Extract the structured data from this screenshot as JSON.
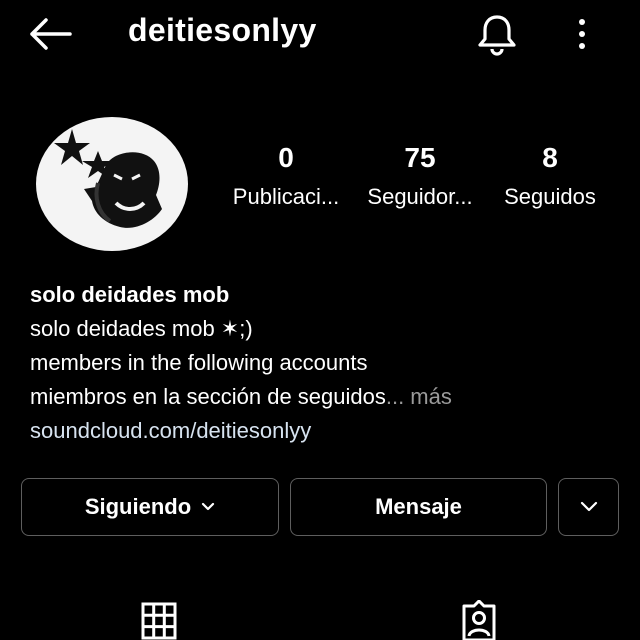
{
  "header": {
    "username": "deitiesonlyy",
    "back_icon": "arrow-left-icon",
    "notifications_icon": "bell-icon",
    "menu_icon": "more-vertical-icon"
  },
  "profile": {
    "avatar_icon": "profile-avatar",
    "stats": [
      {
        "value": "0",
        "label": "Publicaci..."
      },
      {
        "value": "75",
        "label": "Seguidor..."
      },
      {
        "value": "8",
        "label": "Seguidos"
      }
    ]
  },
  "bio": {
    "name": "solo deidades mob",
    "lines": [
      "solo deidades mob ✶;)",
      "members in the following accounts",
      "miembros en la sección de seguidos"
    ],
    "more": "... más",
    "link": "soundcloud.com/deitiesonlyy"
  },
  "actions": {
    "following_label": "Siguiendo",
    "message_label": "Mensaje",
    "dropdown_icon": "chevron-down-icon"
  },
  "tabs": {
    "grid_icon": "grid-icon",
    "tagged_icon": "tagged-icon"
  }
}
